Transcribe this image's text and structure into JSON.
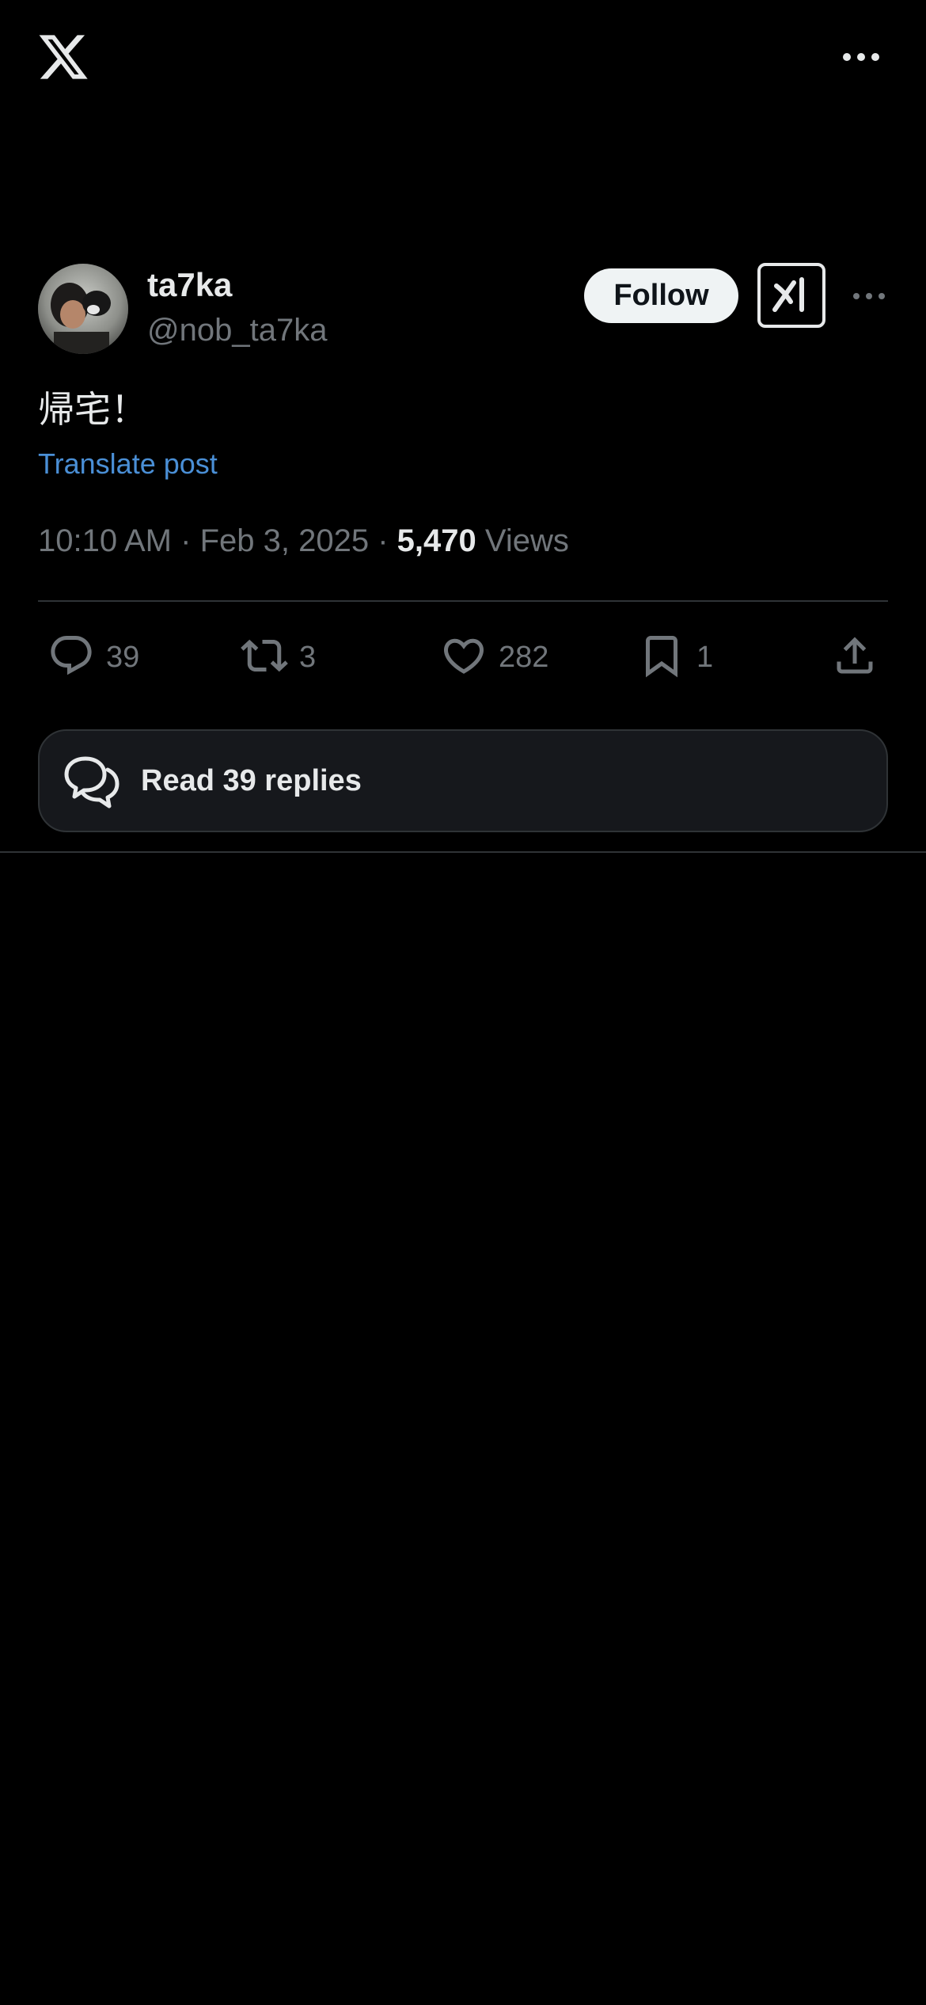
{
  "app": {
    "logo_icon": "x-logo-icon",
    "more_icon": "more-horizontal-icon"
  },
  "author": {
    "display_name": "ta7ka",
    "handle": "@nob_ta7ka",
    "follow_label": "Follow",
    "grok_icon": "grok-icon"
  },
  "post": {
    "text": "帰宅！",
    "translate_label": "Translate post",
    "time": "10:10 AM",
    "date": "Feb 3, 2025",
    "separator": "·",
    "views_count": "5,470",
    "views_label": "Views"
  },
  "actions": {
    "replies": "39",
    "reposts": "3",
    "likes": "282",
    "bookmarks": "1"
  },
  "replies_button": {
    "label": "Read 39 replies"
  },
  "colors": {
    "background": "#000000",
    "text_primary": "#e7e9ea",
    "text_secondary": "#71767b",
    "link": "#4a8fd6",
    "divider": "#2f3336"
  }
}
